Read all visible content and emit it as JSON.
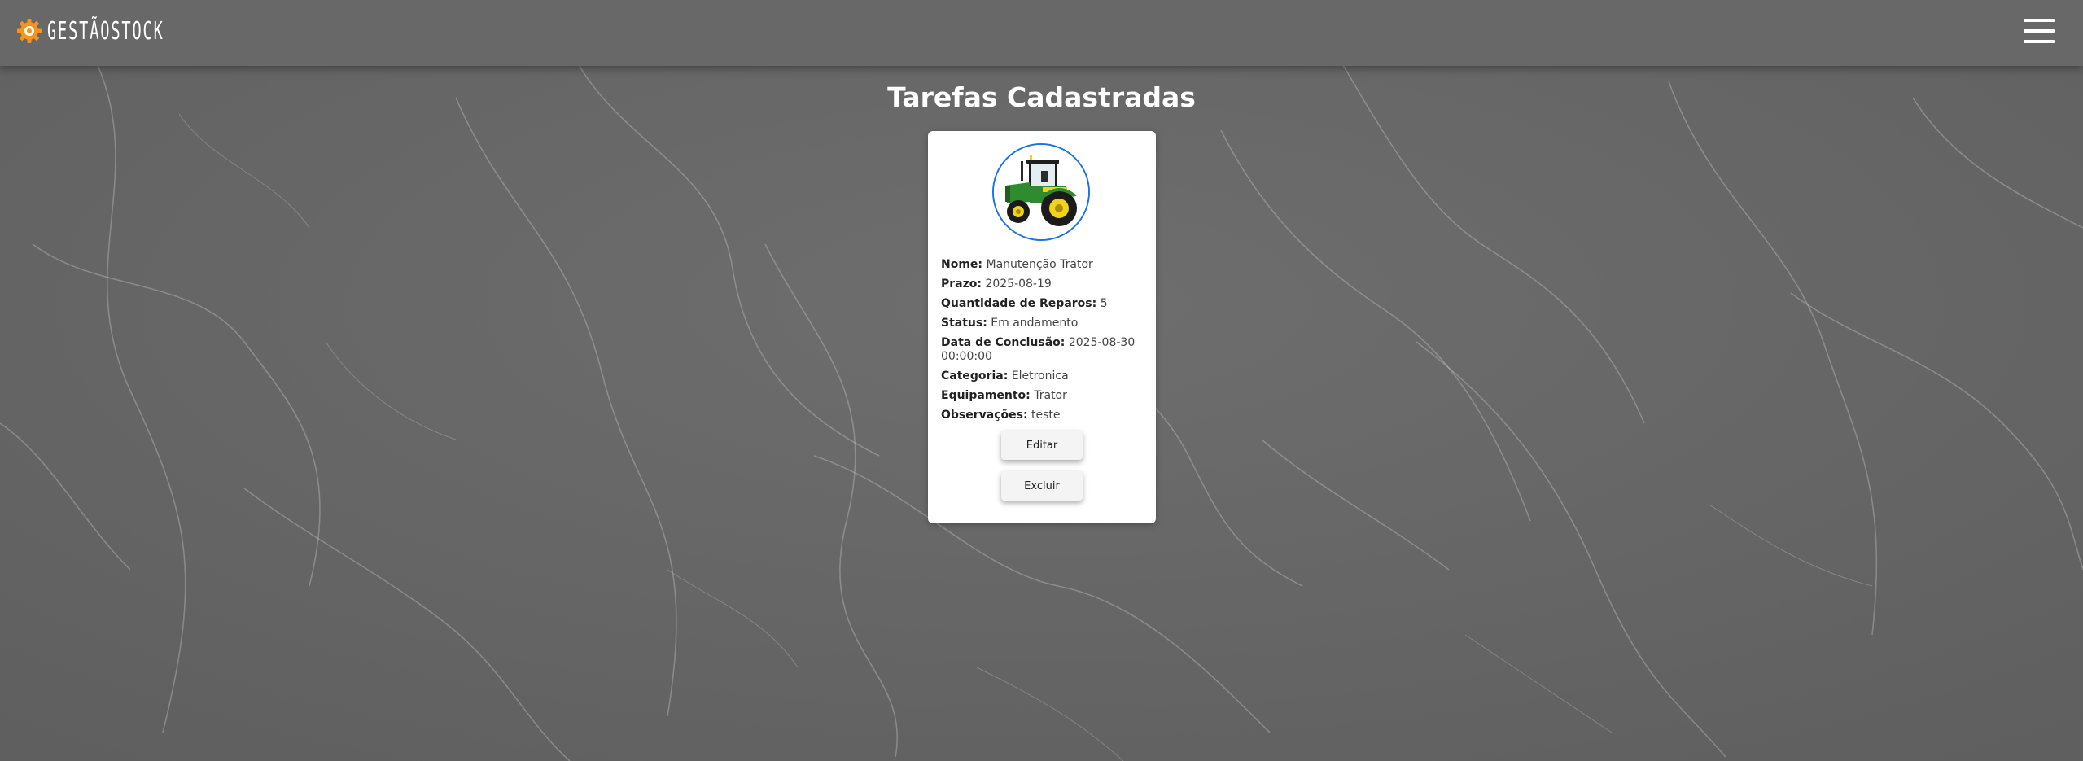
{
  "header": {
    "logo_text": "GESTÃOSTOCK",
    "menu_icon": "hamburger-menu-icon",
    "logo_icon": "gear-icon"
  },
  "main": {
    "title": "Tarefas Cadastradas"
  },
  "task_card": {
    "image": "tractor-image",
    "fields": [
      {
        "label": "Nome:",
        "value": "Manutenção Trator"
      },
      {
        "label": "Prazo:",
        "value": "2025-08-19"
      },
      {
        "label": "Quantidade de Reparos:",
        "value": "5"
      },
      {
        "label": "Status:",
        "value": "Em andamento"
      },
      {
        "label": "Data de Conclusão:",
        "value": "2025-08-30 00:00:00"
      },
      {
        "label": "Categoria:",
        "value": "Eletronica"
      },
      {
        "label": "Equipamento:",
        "value": "Trator"
      },
      {
        "label": "Observações:",
        "value": "teste"
      }
    ],
    "edit_label": "Editar",
    "delete_label": "Excluir"
  },
  "colors": {
    "background": "#6a6a6a",
    "navbar": "#686868",
    "logo_accent": "#f7931e",
    "avatar_border": "#1a73e8",
    "tractor_green": "#2e8b2e",
    "tractor_yellow": "#f2d21b"
  }
}
